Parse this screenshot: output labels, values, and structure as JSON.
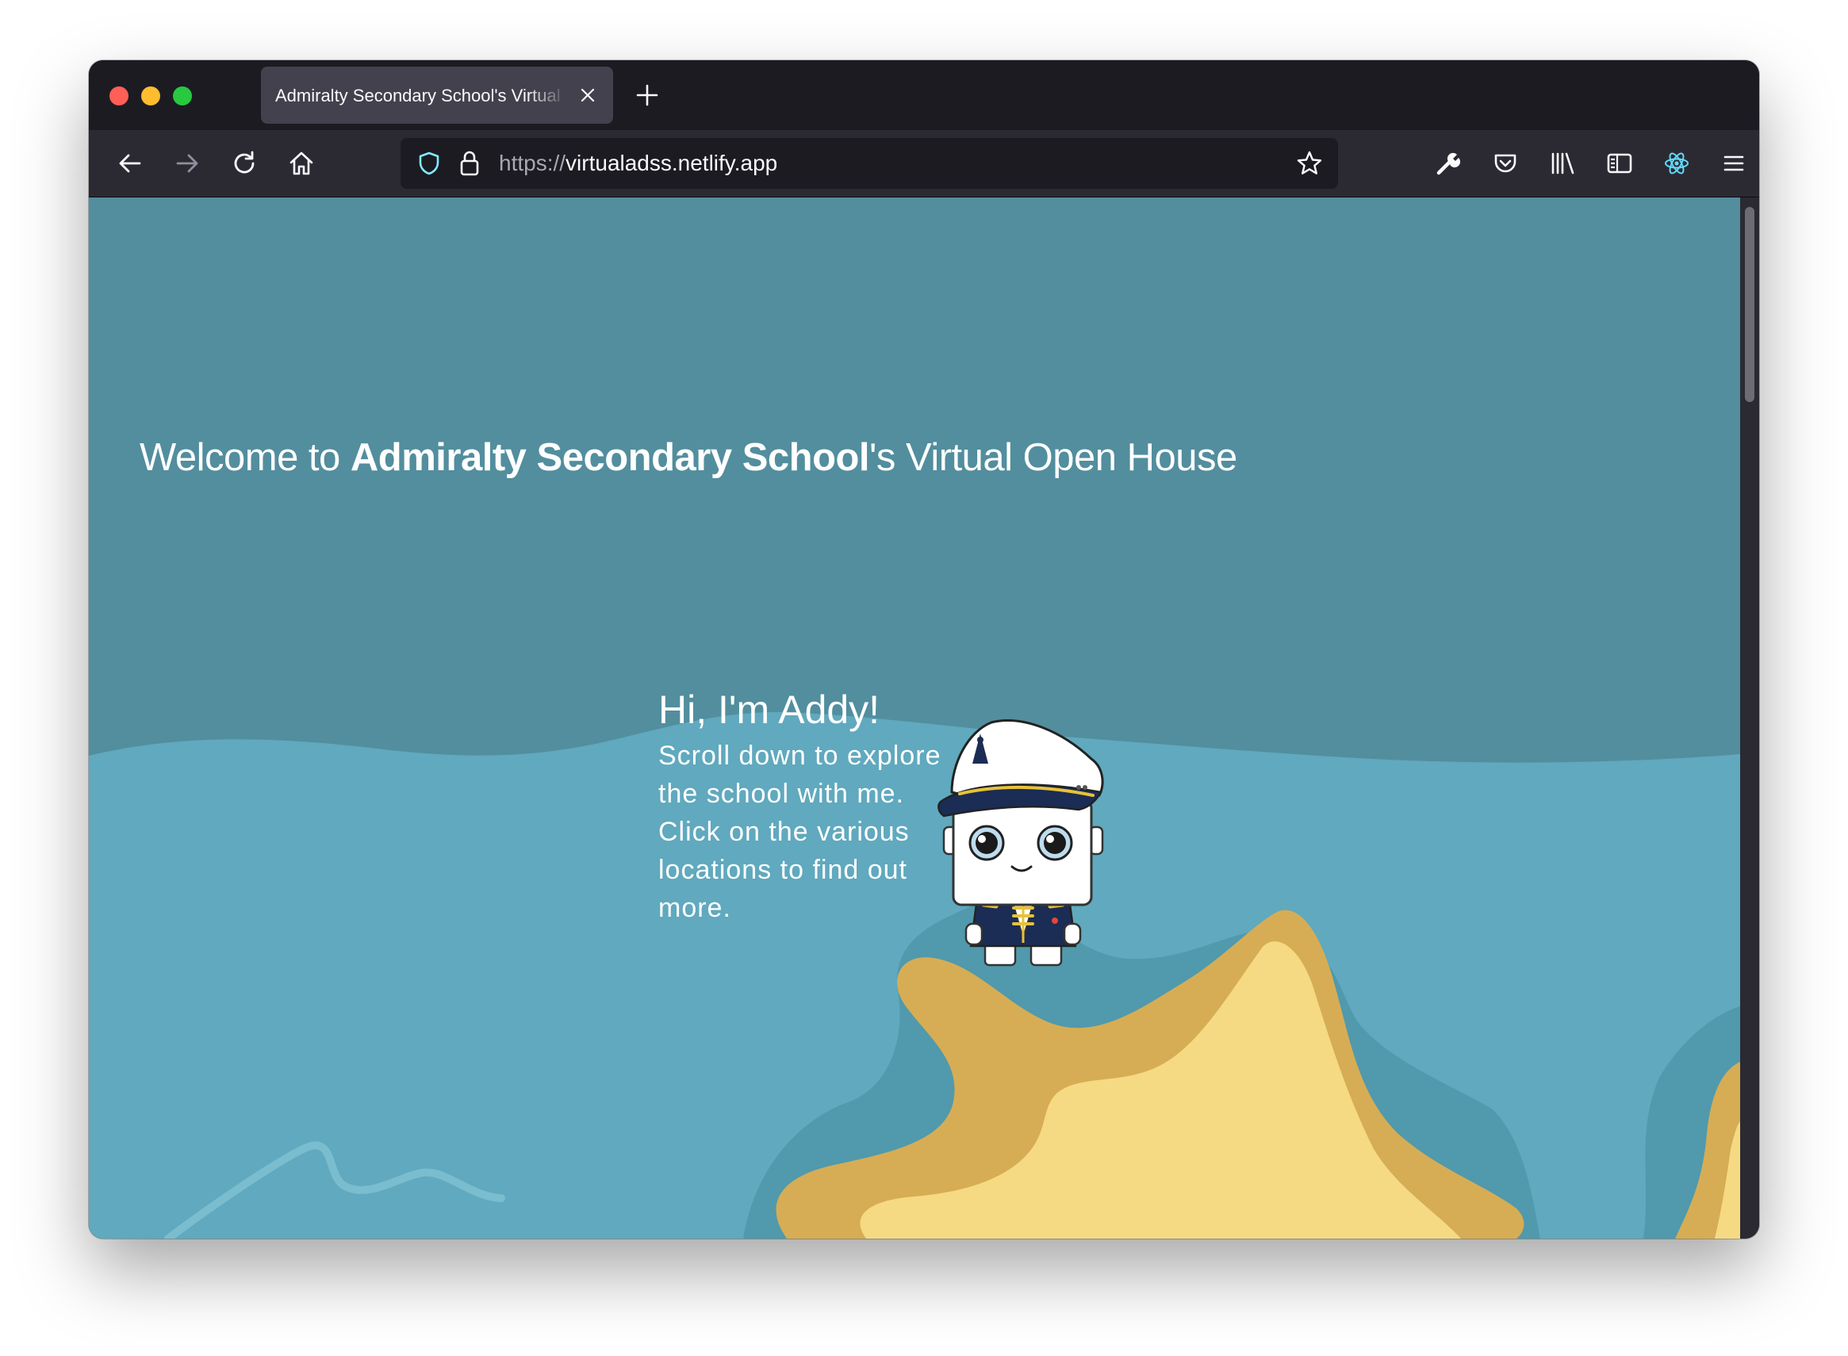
{
  "browser": {
    "tab": {
      "title": "Admiralty Secondary School's Virtual Open House"
    },
    "address_bar": {
      "scheme": "https://",
      "host": "virtualadss.netlify.app"
    }
  },
  "page": {
    "welcome": {
      "prefix": "Welcome to ",
      "school": "Admiralty Secondary School",
      "suffix": "'s Virtual Open House"
    },
    "addy": {
      "greeting": "Hi, I'm Addy!",
      "message": "Scroll down to explore the school with me. Click on the various locations to find out more."
    }
  },
  "colors": {
    "sky": "#528e9e",
    "sea": "#60a9be",
    "sand": "#f5da83",
    "sand_edge": "#d6ad54",
    "toolbar": "#2b2a33",
    "tabstrip": "#1c1b22"
  },
  "icons": [
    "close-icon",
    "plus-icon",
    "back-arrow-icon",
    "forward-arrow-icon",
    "reload-icon",
    "home-icon",
    "shield-icon",
    "lock-icon",
    "star-icon",
    "wrench-icon",
    "pocket-icon",
    "library-icon",
    "sidebar-icon",
    "react-devtools-icon",
    "hamburger-menu-icon"
  ]
}
